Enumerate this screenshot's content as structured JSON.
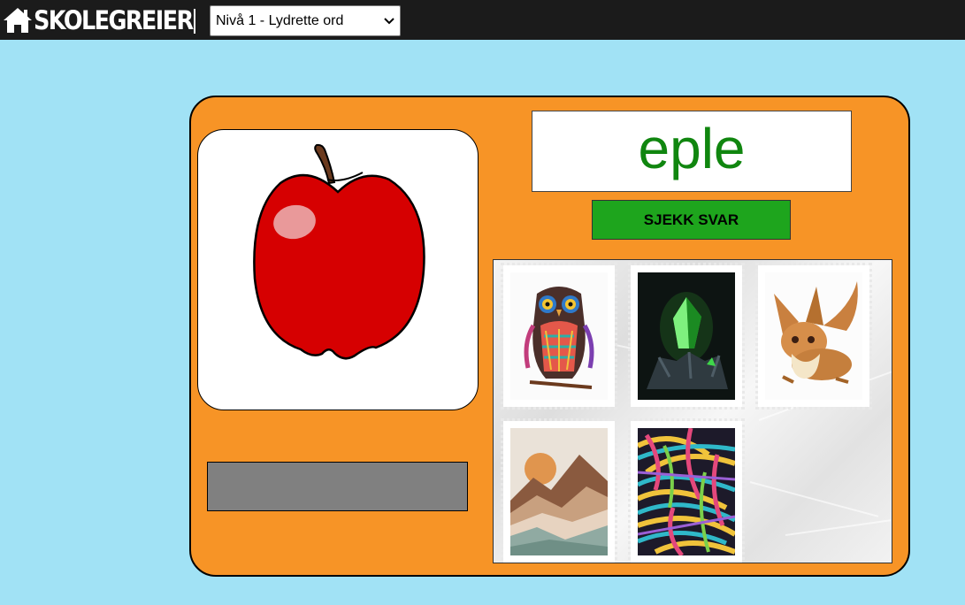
{
  "header": {
    "logo_text": "SKOLEGREIER",
    "level_select": {
      "selected": "Nivå 1 - Lydrette ord"
    }
  },
  "exercise": {
    "word": "eple",
    "check_button": "SJEKK SVAR",
    "picture": "apple",
    "word_color": "#10860f"
  },
  "stamps": [
    {
      "name": "owl"
    },
    {
      "name": "green-crystal"
    },
    {
      "name": "eevee"
    },
    {
      "name": "desert-mountains"
    },
    {
      "name": "colorful-feathers"
    }
  ],
  "colors": {
    "background": "#a1e2f5",
    "card": "#f79426",
    "topbar": "#1b1b1b",
    "button": "#1ea51d",
    "answer_bar": "#808080"
  }
}
